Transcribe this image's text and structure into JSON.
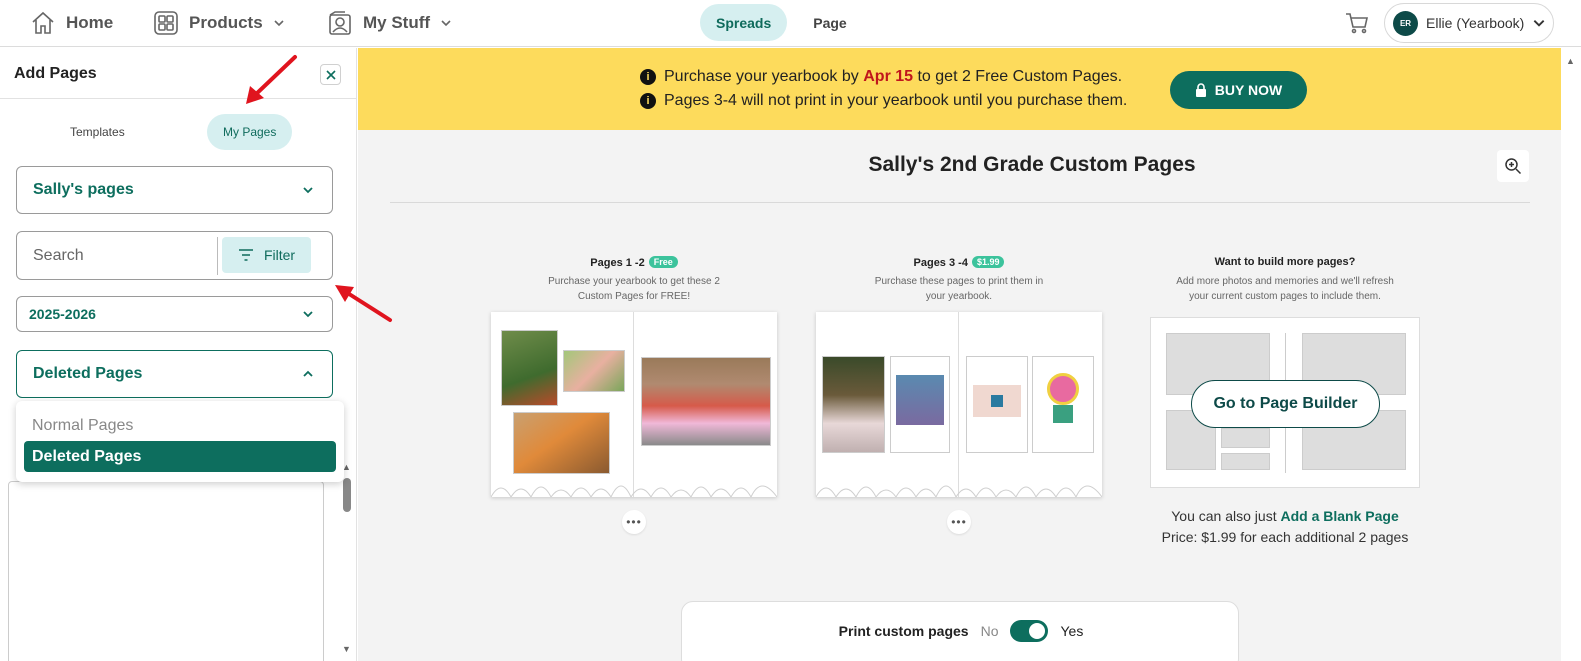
{
  "nav": {
    "home": "Home",
    "products": "Products",
    "my_stuff": "My Stuff",
    "view_spreads": "Spreads",
    "view_page": "Page",
    "user_initials": "ER",
    "user_name": "Ellie (Yearbook)"
  },
  "sidebar": {
    "title": "Add Pages",
    "tabs": [
      "Templates",
      "My Pages"
    ],
    "active_tab": "My Pages",
    "collection_select": "Sally's pages",
    "search_placeholder": "Search",
    "filter_label": "Filter",
    "year_select": "2025-2026",
    "page_type_select": "Deleted Pages",
    "page_type_options": [
      "Normal Pages",
      "Deleted Pages"
    ]
  },
  "banner": {
    "line1_before": "Purchase your yearbook by",
    "line1_date": "Apr 15",
    "line1_after": "to get 2 Free Custom Pages.",
    "line2": "Pages 3-4 will not print in your yearbook until you purchase them.",
    "buy_label": "BUY NOW"
  },
  "main": {
    "title": "Sally's 2nd Grade Custom Pages",
    "spread1": {
      "heading": "Pages 1 -2",
      "badge": "Free",
      "sub1": "Purchase your yearbook to get these 2",
      "sub2": "Custom Pages for FREE!"
    },
    "spread2": {
      "heading": "Pages 3 -4",
      "badge": "$1.99",
      "sub1": "Purchase these pages to print them in",
      "sub2": "your yearbook."
    },
    "builder": {
      "heading": "Want to build more pages?",
      "sub1": "Add more photos and memories and we'll refresh",
      "sub2": "your current custom pages to include them.",
      "button": "Go to Page Builder",
      "blank_prefix": "You can also just",
      "blank_link": "Add a Blank Page",
      "price": "Price: $1.99 for each additional 2 pages"
    },
    "print": {
      "label": "Print custom pages",
      "no": "No",
      "yes": "Yes",
      "enabled": true
    }
  },
  "colors": {
    "brand_green": "#0d6e5e",
    "banner_yellow": "#fddb5c",
    "date_red": "#c0161c",
    "annotation_arrow": "#e0141e"
  }
}
